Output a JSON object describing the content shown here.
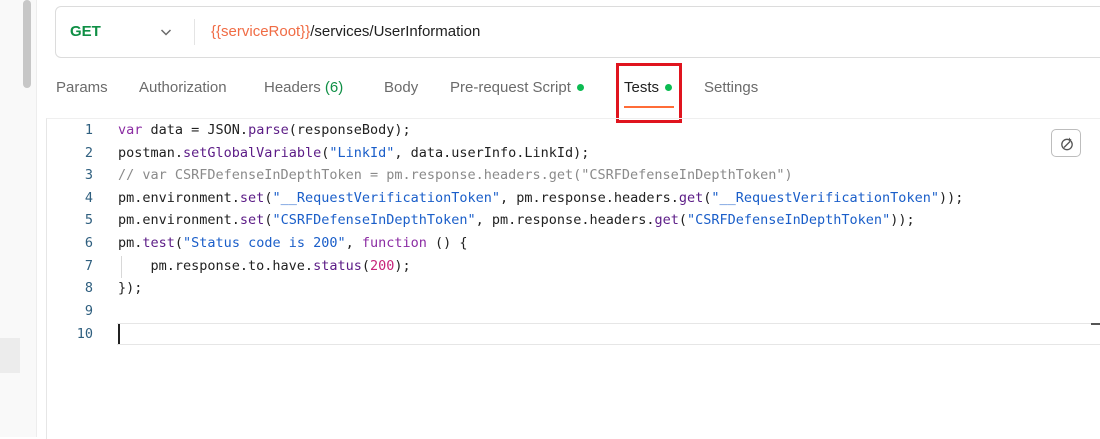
{
  "request": {
    "method": "GET",
    "url_variable": "{{serviceRoot}}",
    "url_path": "/services/UserInformation"
  },
  "tabs": [
    {
      "label": "Params"
    },
    {
      "label": "Authorization"
    },
    {
      "label": "Headers",
      "count": "(6)"
    },
    {
      "label": "Body"
    },
    {
      "label": "Pre-request Script"
    },
    {
      "label": "Tests"
    },
    {
      "label": "Settings"
    }
  ],
  "active_tab": "Tests",
  "editor": {
    "line_numbers": [
      "1",
      "2",
      "3",
      "4",
      "5",
      "6",
      "7",
      "8",
      "9",
      "10"
    ]
  },
  "colors": {
    "method": "#0f8f45",
    "url_variable": "#f06c45",
    "active_tab_underline": "#ff6c37",
    "status_dot": "#0cbb52",
    "highlight_box": "#e0141e"
  },
  "icons": [
    "chevron-down-icon",
    "beautify-icon"
  ]
}
